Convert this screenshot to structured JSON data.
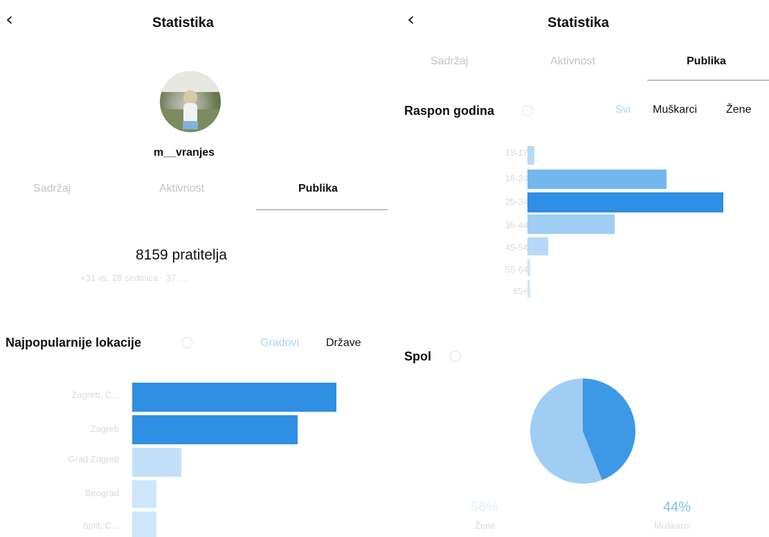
{
  "left": {
    "title": "Statistika",
    "username": "m__vranjes",
    "tabs": [
      "Sadržaj",
      "Aktivnost",
      "Publika"
    ],
    "followers": "8159 pratitelja",
    "followers_sub": "+31 vs. 28 sedmica · 37 ...",
    "locations": {
      "title": "Najpopularnije lokacije",
      "filters": [
        "Gradovi",
        "Države"
      ],
      "cities": [
        "Zagreb, C...",
        "Zagreb",
        "Grad Zagreb",
        "Beograd",
        "Split, C..."
      ]
    }
  },
  "right": {
    "title": "Statistika",
    "tabs": [
      "Sadržaj",
      "Aktivnost",
      "Publika"
    ],
    "age": {
      "title": "Raspon godina",
      "filters": [
        "Svi",
        "Muškarci",
        "Žene"
      ],
      "ranges": [
        "13-17",
        "18-24",
        "25-34",
        "35-44",
        "45-54",
        "55-64",
        "65+"
      ]
    },
    "gender": {
      "title": "Spol",
      "women_pct": "56%",
      "women_label": "Žene",
      "men_pct": "44%",
      "men_label": "Muškarci"
    }
  },
  "chart_data": [
    {
      "type": "bar",
      "orientation": "horizontal",
      "categories": [
        "Zagreb, C...",
        "Zagreb",
        "Grad Zagreb",
        "Beograd",
        "Split, C..."
      ],
      "values": [
        100,
        81,
        24,
        12,
        12
      ],
      "title": "Najpopularnije lokacije",
      "colors": [
        "#2f8fe3",
        "#2f8fe3",
        "#c3e0f8",
        "#cfe6fa",
        "#cfe6fa"
      ]
    },
    {
      "type": "bar",
      "orientation": "horizontal",
      "categories": [
        "13-17",
        "18-24",
        "25-34",
        "35-44",
        "45-54",
        "55-64",
        "65+"
      ],
      "values": [
        4,
        71,
        100,
        45,
        11,
        2,
        2
      ],
      "title": "Raspon godina",
      "colors": [
        "#b6d9f7",
        "#73b7ee",
        "#2f8fe3",
        "#9fcdf4",
        "#b6d9f7",
        "#cfe6fa",
        "#cfe6fa"
      ]
    },
    {
      "type": "pie",
      "categories": [
        "Muškarci",
        "Žene"
      ],
      "values": [
        44,
        56
      ],
      "title": "Spol",
      "colors": [
        "#3d98e6",
        "#9fcdf4"
      ]
    }
  ]
}
